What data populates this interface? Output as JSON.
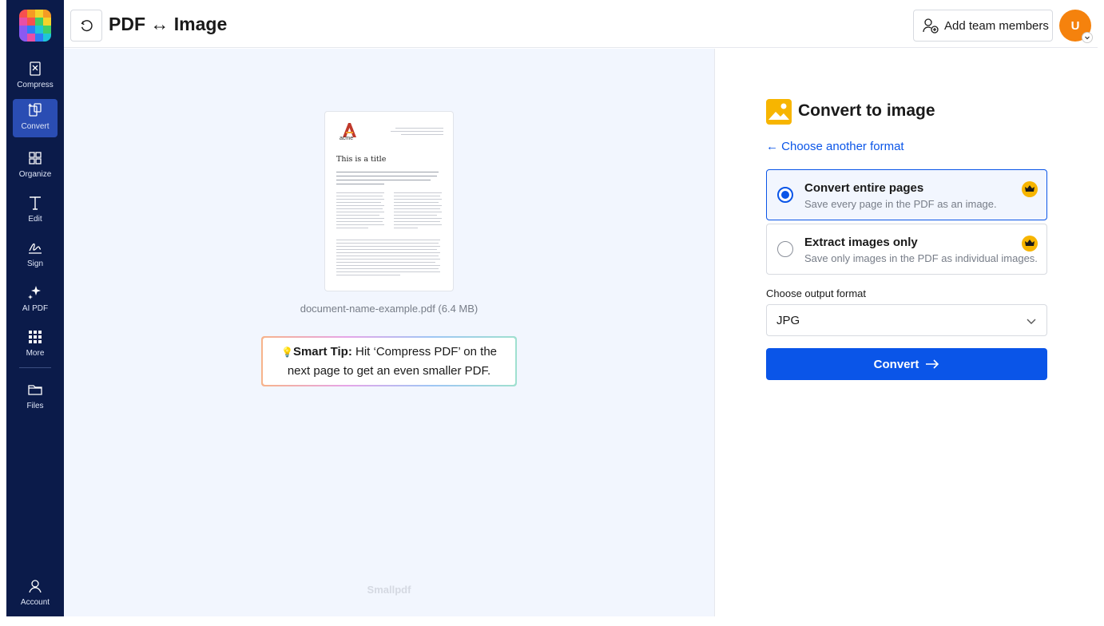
{
  "app": {
    "title": "PDF ↔ Image",
    "brand_colors": [
      "#f7504f",
      "#f59b23",
      "#f5d32b",
      "#3fce6a",
      "#1ec6d8",
      "#2f7cf6",
      "#8b59f2",
      "#e84fa6"
    ]
  },
  "sidebar": {
    "items": [
      {
        "label": "Compress",
        "icon": "compress-icon"
      },
      {
        "label": "Convert",
        "icon": "convert-icon"
      },
      {
        "label": "Organize",
        "icon": "grid-icon"
      },
      {
        "label": "Edit",
        "icon": "text-edit-icon"
      },
      {
        "label": "Sign",
        "icon": "signature-icon"
      },
      {
        "label": "AI PDF",
        "icon": "sparkle-icon"
      },
      {
        "label": "More",
        "icon": "apps-grid-icon"
      },
      {
        "label": "Files",
        "icon": "folder-icon"
      },
      {
        "label": "Account",
        "icon": "user-icon"
      }
    ],
    "active": "Convert"
  },
  "header": {
    "add_team_label": "Add team members",
    "avatar_initial": "U"
  },
  "preview": {
    "file_name": "document-name-example.pdf (6.4 MB)",
    "doc_logo_text": "acme",
    "doc_title": "This is a title",
    "tip_bold": "Smart Tip:",
    "tip_text": " Hit ‘Compress PDF’ on the next page to get an even smaller PDF.",
    "tip_icon": "💡",
    "watermark": "Smallpdf"
  },
  "panel": {
    "title": "Convert to image",
    "change_link": "← Choose another format",
    "options": [
      {
        "title": "Convert entire pages",
        "subtitle": "Save every page in the PDF as an image.",
        "selected": true
      },
      {
        "title": "Extract images only",
        "subtitle": "Save only images in the PDF as individual images.",
        "selected": false
      }
    ],
    "format_label": "Choose output format",
    "format_value": "JPG",
    "convert_label": "Convert"
  },
  "colors": {
    "sidebar": "#0b1b4a",
    "accent": "#0a55e8",
    "premium": "#f7b500",
    "avatar": "#f5820d"
  }
}
